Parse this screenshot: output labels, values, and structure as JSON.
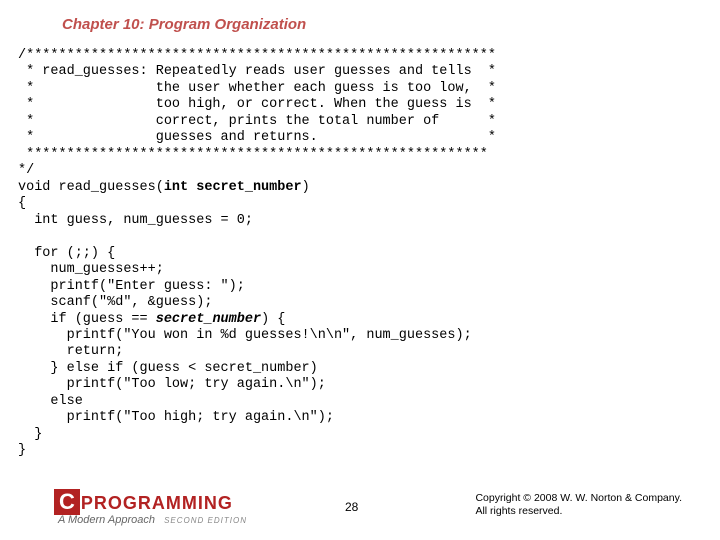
{
  "chapter_title": "Chapter 10: Program Organization",
  "comment_block": {
    "stars_top": "/**********************************************************",
    "l1": " * read_guesses: Repeatedly reads user guesses and tells  *",
    "l2": " *               the user whether each guess is too low,  *",
    "l3": " *               too high, or correct. When the guess is  *",
    "l4": " *               correct, prints the total number of      *",
    "l5": " *               guesses and returns.                     *",
    "stars_bot": " *********************************************************",
    "tail": "*/"
  },
  "code": {
    "sig_pre": "void read_guesses(",
    "sig_kw": "int",
    "sig_sp": " ",
    "sig_param": "secret_number",
    "sig_post": ")",
    "brace_open": "{",
    "decl": "  int guess, num_guesses = 0;",
    "for_line": "  for (;;) {",
    "inc": "    num_guesses++;",
    "p1": "    printf(\"Enter guess: \");",
    "scan": "    scanf(\"%d\", &guess);",
    "if_pre": "    if (guess == ",
    "if_secret": "secret_number",
    "if_post": ") {",
    "won": "      printf(\"You won in %d guesses!\\n\\n\", num_guesses);",
    "ret": "      return;",
    "elseif": "    } else if (guess < secret_number)",
    "low": "      printf(\"Too low; try again.\\n\");",
    "else": "    else",
    "high": "      printf(\"Too high; try again.\\n\");",
    "for_close": "  }",
    "brace_close": "}"
  },
  "logo": {
    "c": "C",
    "text": "PROGRAMMING",
    "sub": "A Modern Approach",
    "edition": "SECOND EDITION"
  },
  "page_number": "28",
  "copyright": {
    "l1": "Copyright © 2008 W. W. Norton & Company.",
    "l2": "All rights reserved."
  }
}
